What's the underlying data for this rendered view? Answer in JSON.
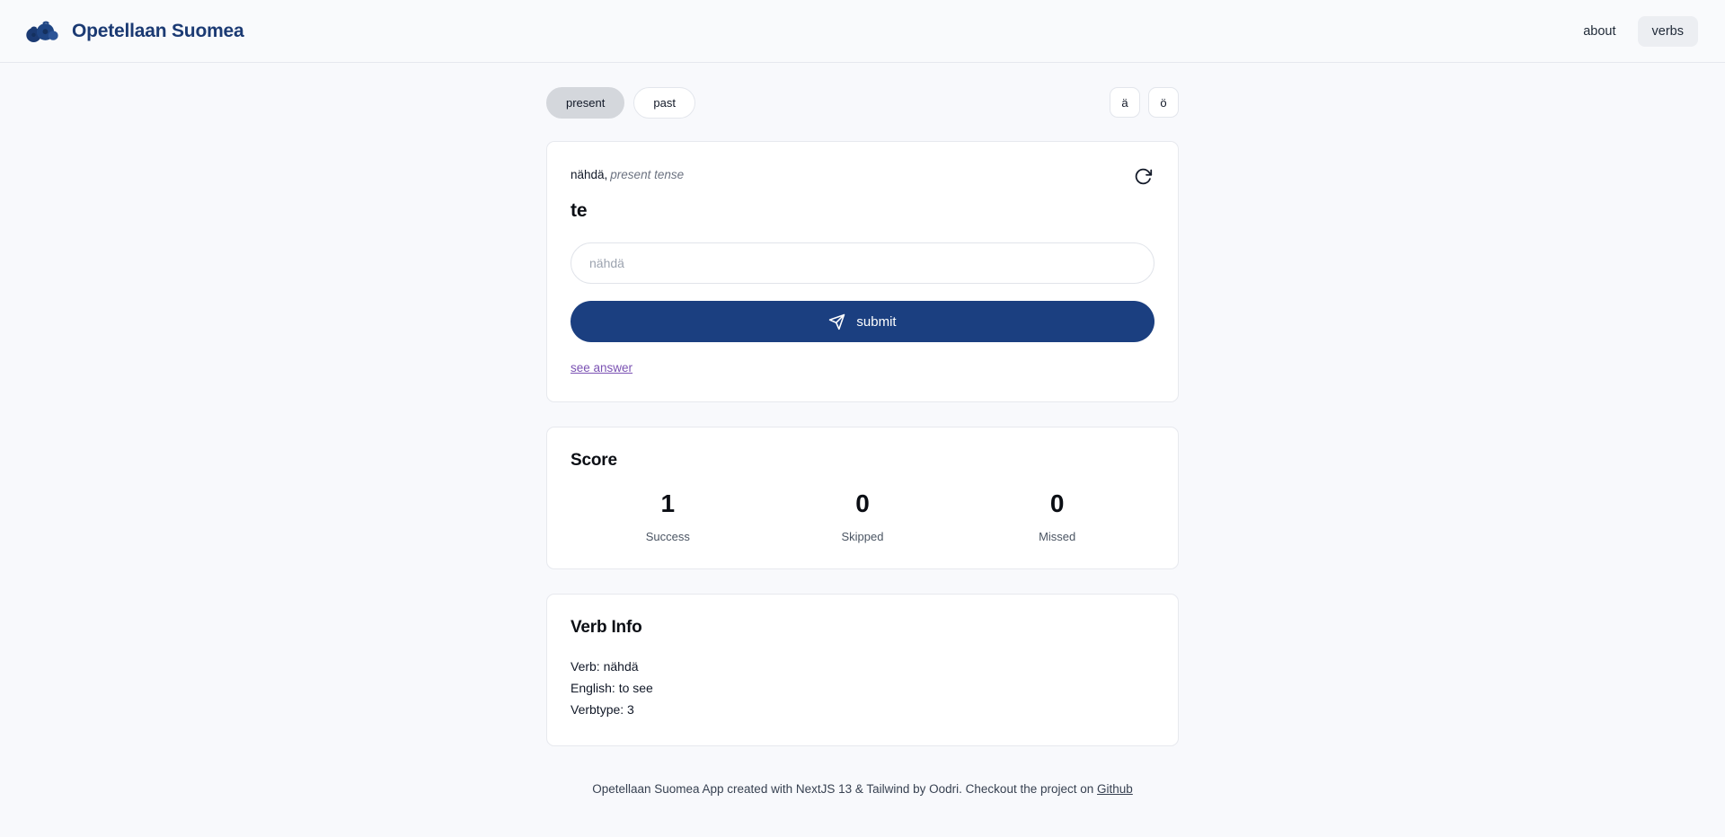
{
  "header": {
    "brand_title": "Opetellaan Suomea",
    "logo_icon": "blueberries-icon",
    "nav": [
      {
        "label": "about",
        "active": false
      },
      {
        "label": "verbs",
        "active": true
      }
    ]
  },
  "toolbar": {
    "tenses": [
      {
        "label": "present",
        "selected": true
      },
      {
        "label": "past",
        "selected": false
      }
    ],
    "special_chars": [
      {
        "label": "ä"
      },
      {
        "label": "ö"
      }
    ]
  },
  "quiz": {
    "verb": "nähdä,",
    "tense_label": "present tense",
    "refresh_icon": "refresh-cw-icon",
    "pronoun": "te",
    "input_value": "",
    "input_placeholder": "nähdä",
    "submit_icon": "send-icon",
    "submit_label": "submit",
    "see_answer_label": "see answer"
  },
  "score": {
    "title": "Score",
    "items": [
      {
        "value": "1",
        "label": "Success"
      },
      {
        "value": "0",
        "label": "Skipped"
      },
      {
        "value": "0",
        "label": "Missed"
      }
    ]
  },
  "verb_info": {
    "title": "Verb Info",
    "lines": [
      "Verb: nähdä",
      "English: to see",
      "Verbtype: 3"
    ]
  },
  "footer": {
    "text": "Opetellaan Suomea App created with NextJS 13 & Tailwind by Oodri. Checkout the project on",
    "link_label": "Github"
  },
  "colors": {
    "brand": "#1b3a73",
    "submit": "#1b3f80",
    "page_bg": "#f8f9fc",
    "link": "#7b52b3"
  }
}
